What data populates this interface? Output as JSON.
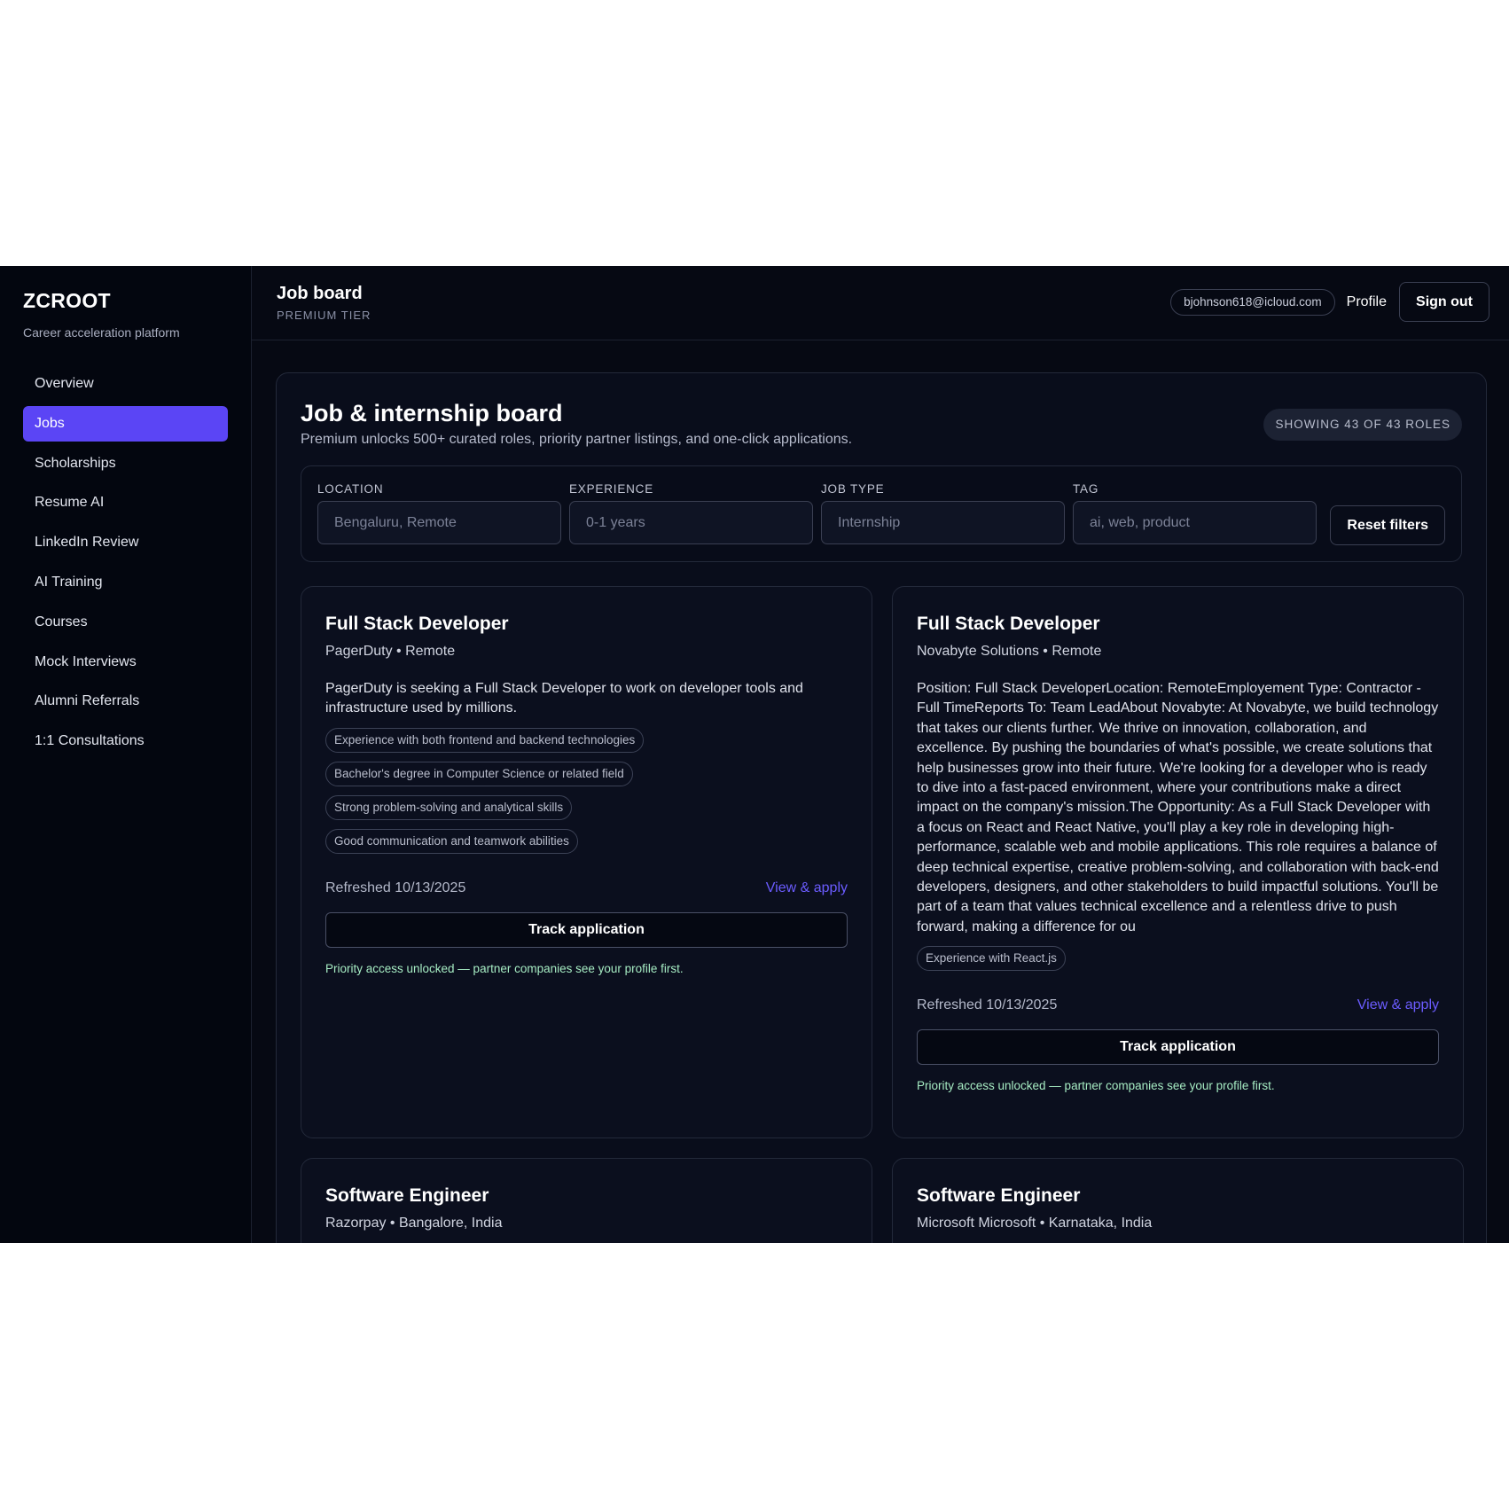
{
  "sidebar": {
    "brand": "ZCROOT",
    "tagline": "Career acceleration platform",
    "items": [
      {
        "label": "Overview",
        "active": false
      },
      {
        "label": "Jobs",
        "active": true
      },
      {
        "label": "Scholarships",
        "active": false
      },
      {
        "label": "Resume AI",
        "active": false
      },
      {
        "label": "LinkedIn Review",
        "active": false
      },
      {
        "label": "AI Training",
        "active": false
      },
      {
        "label": "Courses",
        "active": false
      },
      {
        "label": "Mock Interviews",
        "active": false
      },
      {
        "label": "Alumni Referrals",
        "active": false
      },
      {
        "label": "1:1 Consultations",
        "active": false
      }
    ]
  },
  "header": {
    "title": "Job board",
    "tier": "PREMIUM TIER",
    "email": "bjohnson618@icloud.com",
    "profile_label": "Profile",
    "signout_label": "Sign out"
  },
  "board": {
    "title": "Job & internship board",
    "description": "Premium unlocks 500+ curated roles, priority partner listings, and one-click applications.",
    "count_badge": "SHOWING 43 OF 43 ROLES",
    "filters": {
      "location": {
        "label": "LOCATION",
        "value": "",
        "placeholder": "Bengaluru, Remote"
      },
      "experience": {
        "label": "EXPERIENCE",
        "value": "",
        "placeholder": "0-1 years"
      },
      "job_type": {
        "label": "JOB TYPE",
        "value": "",
        "placeholder": "Internship"
      },
      "tag": {
        "label": "TAG",
        "value": "",
        "placeholder": "ai, web, product"
      },
      "reset_label": "Reset filters"
    }
  },
  "jobs": [
    {
      "title": "Full Stack Developer",
      "meta": "PagerDuty • Remote",
      "description": "PagerDuty is seeking a Full Stack Developer to work on developer tools and infrastructure used by millions.",
      "tags": [
        "Experience with both frontend and backend technologies",
        "Bachelor's degree in Computer Science or related field",
        "Strong problem-solving and analytical skills",
        "Good communication and teamwork abilities"
      ],
      "refreshed": "Refreshed 10/13/2025",
      "apply_label": "View & apply",
      "track_label": "Track application",
      "priority_note": "Priority access unlocked — partner companies see your profile first."
    },
    {
      "title": "Full Stack Developer",
      "meta": "Novabyte Solutions • Remote",
      "description": "Position: Full Stack DeveloperLocation: RemoteEmployement Type: Contractor - Full TimeReports To: Team LeadAbout Novabyte: At Novabyte, we build technology that takes our clients further. We thrive on innovation, collaboration, and excellence. By pushing the boundaries of what's possible, we create solutions that help businesses grow into their future. We're looking for a developer who is ready to dive into a fast-paced environment, where your contributions make a direct impact on the company's mission.The Opportunity: As a Full Stack Developer with a focus on React and React Native, you'll play a key role in developing high-performance, scalable web and mobile applications. This role requires a balance of deep technical expertise, creative problem-solving, and collaboration with back-end developers, designers, and other stakeholders to build impactful solutions. You'll be part of a team that values technical excellence and a relentless drive to push forward, making a difference for ou",
      "tags": [
        "Experience with React.js"
      ],
      "refreshed": "Refreshed 10/13/2025",
      "apply_label": "View & apply",
      "track_label": "Track application",
      "priority_note": "Priority access unlocked — partner companies see your profile first."
    },
    {
      "title": "Software Engineer",
      "meta": "Razorpay • Bangalore, India"
    },
    {
      "title": "Software Engineer",
      "meta": "Microsoft Microsoft • Karnataka, India"
    }
  ],
  "colors": {
    "accent": "#5b45f5",
    "link": "#6b5cff",
    "priority": "#a6ecc3",
    "background": "#060913"
  }
}
